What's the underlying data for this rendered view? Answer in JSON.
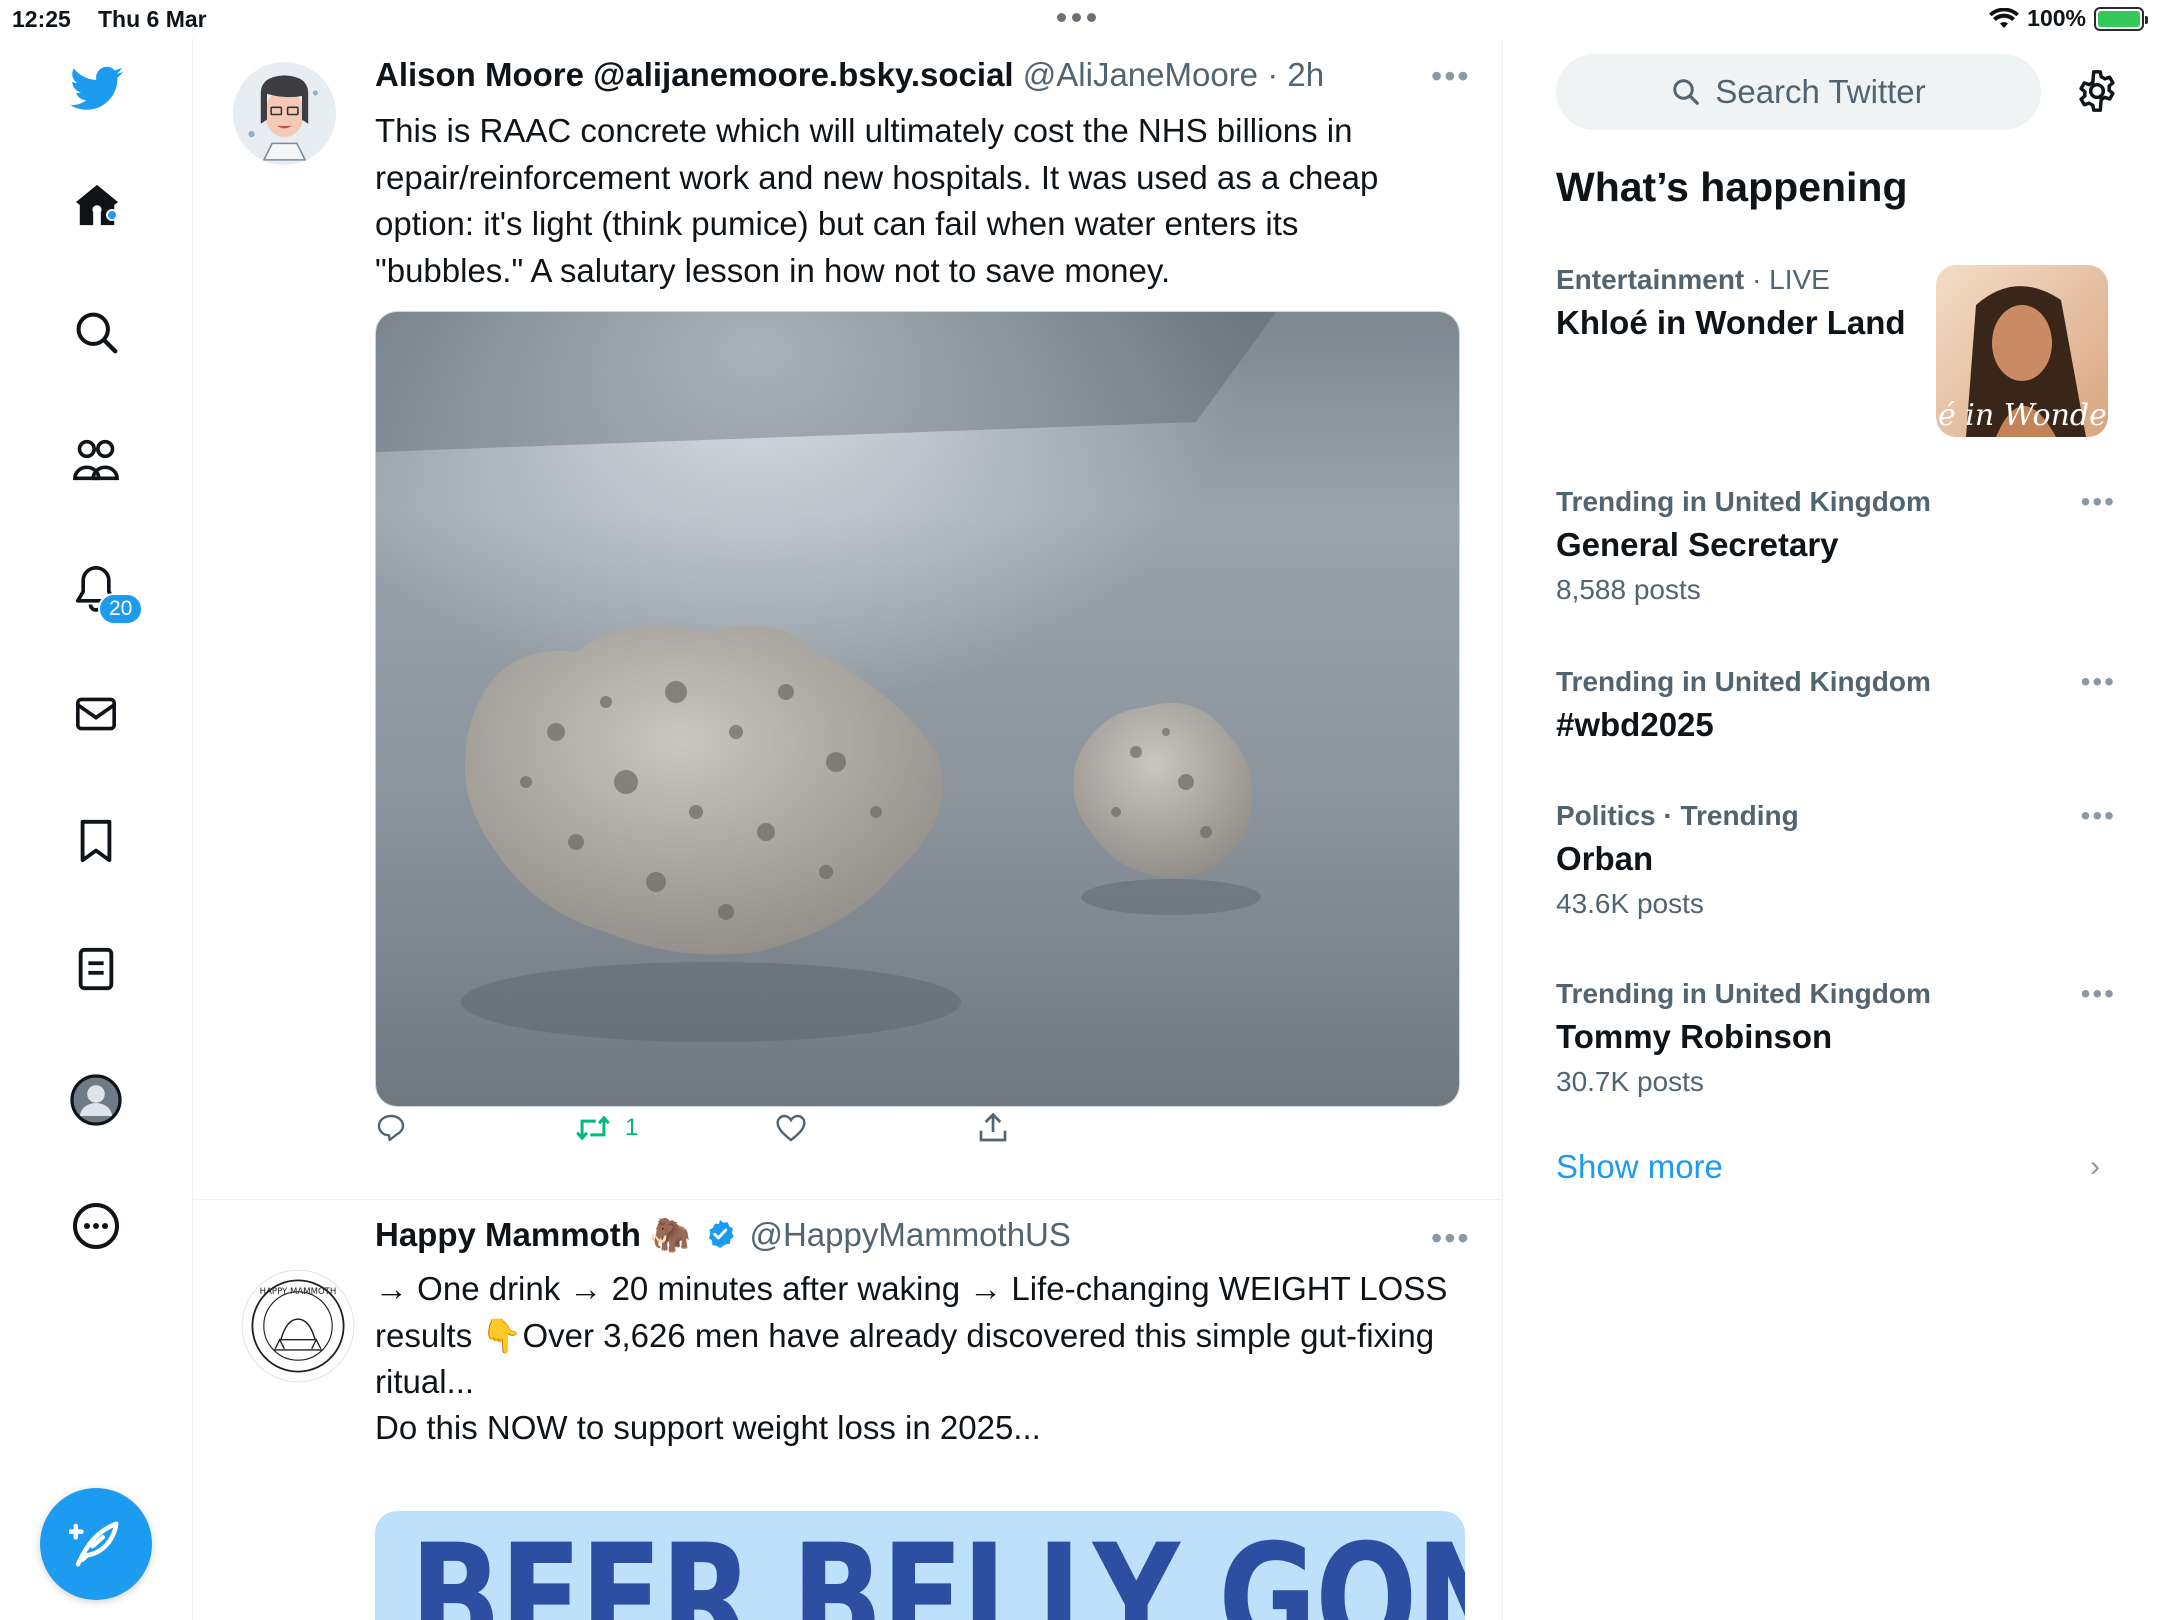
{
  "status_bar": {
    "time": "12:25",
    "date": "Thu 6 Mar",
    "battery": "100%",
    "battery_color": "#34c759"
  },
  "nav": {
    "items": [
      "twitter-logo",
      "home",
      "explore",
      "communities",
      "notifications",
      "messages",
      "bookmarks",
      "lists",
      "profile",
      "more"
    ],
    "notifications_badge": "20",
    "accent": "#1d9bf0"
  },
  "tweets": [
    {
      "name": "Alison Moore @alijanemoore.bsky.social",
      "handle_time": "@AliJaneMoore · 2h",
      "text": "This is RAAC concrete which will ultimately cost the NHS billions in repair/reinforcement work and new hospitals. It was used as a cheap option: it's light (think pumice) but can fail when water enters its \"bubbles.\"  A salutary lesson in how not to save money.",
      "retweets": "1"
    },
    {
      "name": "Happy Mammoth 🦣",
      "handle_time": "@HappyMammothUS",
      "verified": true,
      "avatar_text": "HAPPY MAMMOTH",
      "line1": "→ One drink → 20 minutes after waking → Life-changing WEIGHT LOSS results 👇Over 3,626 men have already discovered this simple gut-fixing ritual...",
      "line2": "Do this NOW to support weight loss in 2025...",
      "banner": "BEER BELLY GONE"
    }
  ],
  "sidebar": {
    "search_placeholder": "Search Twitter",
    "title": "What’s happening",
    "featured": {
      "category": "Entertainment",
      "live": "· LIVE",
      "title": "Khloé in Wonder Land",
      "image_caption": "é in Wonder L"
    },
    "trends": [
      {
        "context": "Trending in United Kingdom",
        "title": "General Secretary",
        "count": "8,588 posts"
      },
      {
        "context": "Trending in United Kingdom",
        "title": "#wbd2025",
        "count": ""
      },
      {
        "context": "Politics · Trending",
        "title": "Orban",
        "count": "43.6K posts"
      },
      {
        "context": "Trending in United Kingdom",
        "title": "Tommy Robinson",
        "count": "30.7K posts"
      }
    ],
    "show_more": "Show more"
  }
}
